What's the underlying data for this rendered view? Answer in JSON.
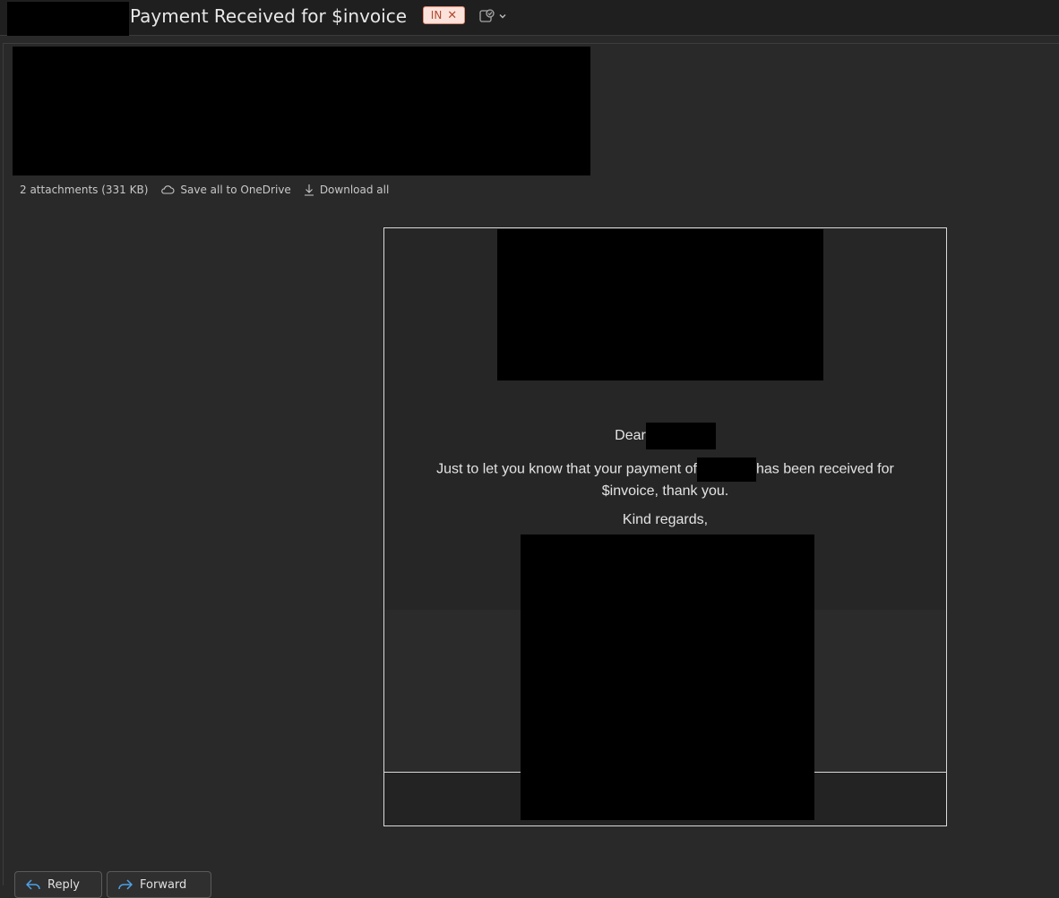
{
  "header": {
    "subject": "Payment Received for $invoice",
    "tag": {
      "label": "IN",
      "remove_glyph": "✕",
      "color": "#b2492f",
      "background": "#fbe3dc"
    },
    "rules_icon": "mail-rules-icon",
    "dropdown_icon": "chevron-down-icon"
  },
  "attachments": {
    "summary": "2 attachments (331 KB)",
    "save_label": "Save all to OneDrive",
    "download_label": "Download all",
    "save_icon": "cloud-icon",
    "download_icon": "download-icon"
  },
  "email": {
    "greeting": "Dear",
    "message_before": "Just to let you know that your payment of",
    "message_after": "has been received for $invoice, thank you.",
    "closing": "Kind regards,"
  },
  "actions": {
    "reply_label": "Reply",
    "forward_label": "Forward",
    "reply_icon": "reply-icon",
    "forward_icon": "forward-icon"
  },
  "colors": {
    "background": "#292929",
    "header": "#1f1f1f",
    "accent_link": "#4ea1e6"
  }
}
